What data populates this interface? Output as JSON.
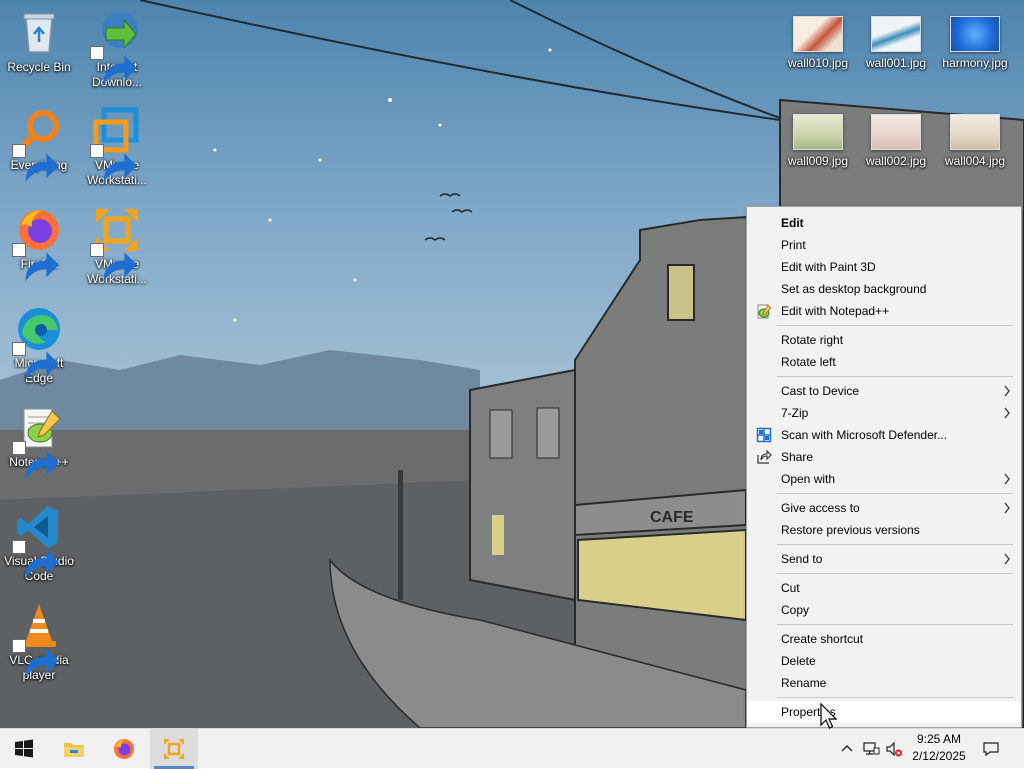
{
  "desktop_icons_left": [
    {
      "label": "Recycle Bin",
      "icon": "recycle-bin-icon"
    },
    {
      "label": "Internet Downlo...",
      "icon": "internet-download-manager-icon"
    },
    {
      "label": "Everything",
      "icon": "everything-search-icon"
    },
    {
      "label": "VMware Workstati...",
      "icon": "vmware-workstation-icon"
    },
    {
      "label": "Firefox",
      "icon": "firefox-icon"
    },
    {
      "label": "VMware Workstati...",
      "icon": "vmware-player-icon"
    },
    {
      "label": "Microsoft Edge",
      "icon": "edge-icon"
    },
    {
      "label": "Notepad++",
      "icon": "notepad-plus-plus-icon"
    },
    {
      "label": "Visual Studio Code",
      "icon": "vscode-icon"
    },
    {
      "label": "VLC media player",
      "icon": "vlc-icon"
    }
  ],
  "desktop_files_right": [
    {
      "label": "wall010.jpg",
      "icon": "image-thumbnail-icon"
    },
    {
      "label": "wall001.jpg",
      "icon": "image-thumbnail-icon"
    },
    {
      "label": "harmony.jpg",
      "icon": "image-thumbnail-icon"
    },
    {
      "label": "wall009.jpg",
      "icon": "image-thumbnail-icon"
    },
    {
      "label": "wall002.jpg",
      "icon": "image-thumbnail-icon"
    },
    {
      "label": "wall004.jpg",
      "icon": "image-thumbnail-icon"
    }
  ],
  "context_menu": {
    "items": [
      {
        "label": "Edit"
      },
      {
        "label": "Print"
      },
      {
        "label": "Edit with Paint 3D"
      },
      {
        "label": "Set as desktop background"
      },
      {
        "label": "Edit with Notepad++",
        "icon": "notepad-plus-plus-icon"
      },
      {
        "label": "Rotate right"
      },
      {
        "label": "Rotate left"
      },
      {
        "label": "Cast to Device"
      },
      {
        "label": "7-Zip"
      },
      {
        "label": "Scan with Microsoft Defender...",
        "icon": "defender-shield-icon"
      },
      {
        "label": "Share",
        "icon": "share-icon"
      },
      {
        "label": "Open with"
      },
      {
        "label": "Give access to"
      },
      {
        "label": "Restore previous versions"
      },
      {
        "label": "Send to"
      },
      {
        "label": "Cut"
      },
      {
        "label": "Copy"
      },
      {
        "label": "Create shortcut"
      },
      {
        "label": "Delete"
      },
      {
        "label": "Rename"
      },
      {
        "label": "Properties"
      }
    ]
  },
  "taskbar": {
    "buttons": [
      {
        "icon": "windows-start-icon"
      },
      {
        "icon": "file-explorer-icon"
      },
      {
        "icon": "firefox-icon"
      },
      {
        "icon": "vmware-icon"
      }
    ],
    "tray": {
      "time": "9:25 AM",
      "date": "2/12/2025"
    }
  },
  "colors": {
    "accent": "#5a88c6",
    "menu_bg": "#f2f2f2",
    "taskbar_bg": "#f1f1f1"
  }
}
